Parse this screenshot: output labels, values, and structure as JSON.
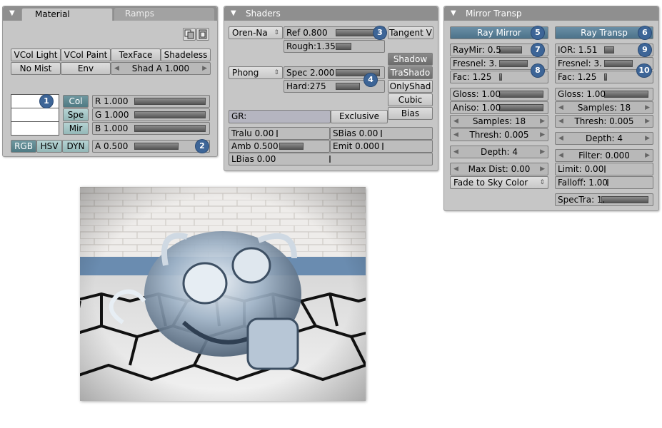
{
  "material_panel": {
    "tabs": [
      "Material",
      "Ramps"
    ],
    "row1": [
      "VCol Light",
      "VCol Paint",
      "TexFace",
      "Shadeless"
    ],
    "row2": [
      "No Mist",
      "Env",
      "Shad A 1.000"
    ],
    "color_buttons": [
      "Col",
      "Spe",
      "Mir"
    ],
    "sliders": [
      "R 1.000",
      "G 1.000",
      "B 1.000",
      "A 0.500"
    ],
    "modes": [
      "RGB",
      "HSV",
      "DYN"
    ],
    "badges": [
      "1",
      "2"
    ]
  },
  "shaders_panel": {
    "title": "Shaders",
    "diffuse_shader": "Oren-Na",
    "ref": "Ref   0.800",
    "rough": "Rough:1.35",
    "tangent": "Tangent V",
    "spec_shader": "Phong",
    "spec": "Spec 2.000",
    "hard": "Hard:275",
    "shadow_buttons": [
      "Shadow",
      "TraShado",
      "OnlyShad",
      "Cubic",
      "Bias"
    ],
    "gr_label": "GR:",
    "exclusive": "Exclusive",
    "tralu": "Tralu 0.00",
    "sbias": "SBias 0.00",
    "amb": "Amb 0.500",
    "emit": "Emit 0.000",
    "lbias": "LBias 0.00",
    "badges": [
      "3",
      "4"
    ]
  },
  "mirror_panel": {
    "title": "Mirror Transp",
    "ray_mirror": "Ray Mirror",
    "ray_transp": "Ray Transp",
    "raymir": "RayMir: 0.5",
    "fresnel_l": "Fresnel: 3.",
    "fac_l": "Fac: 1.25",
    "ior": "IOR: 1.51",
    "fresnel_r": "Fresnel: 3.",
    "fac_r": "Fac: 1.25",
    "gloss_l": "Gloss: 1.00",
    "aniso": "Aniso: 1.00",
    "samples_l": "Samples: 18",
    "thresh_l": "Thresh: 0.005",
    "depth_l": "Depth: 4",
    "maxdist": "Max Dist: 0.00",
    "fade": "Fade to Sky Color",
    "gloss_r": "Gloss: 1.00",
    "samples_r": "Samples: 18",
    "thresh_r": "Thresh: 0.005",
    "depth_r": "Depth: 4",
    "filter": "Filter: 0.000",
    "limit": "Limit: 0.00",
    "falloff": "Falloff: 1.00",
    "spectra": "SpecTra: 1.",
    "badges": [
      "5",
      "6",
      "7",
      "8",
      "9",
      "10"
    ]
  },
  "colors": {
    "panel_bg": "#c6c6c6",
    "header_bg": "#8f8f8f",
    "badge_blue": "#3d6597",
    "toggle_on": "#5d8890"
  }
}
